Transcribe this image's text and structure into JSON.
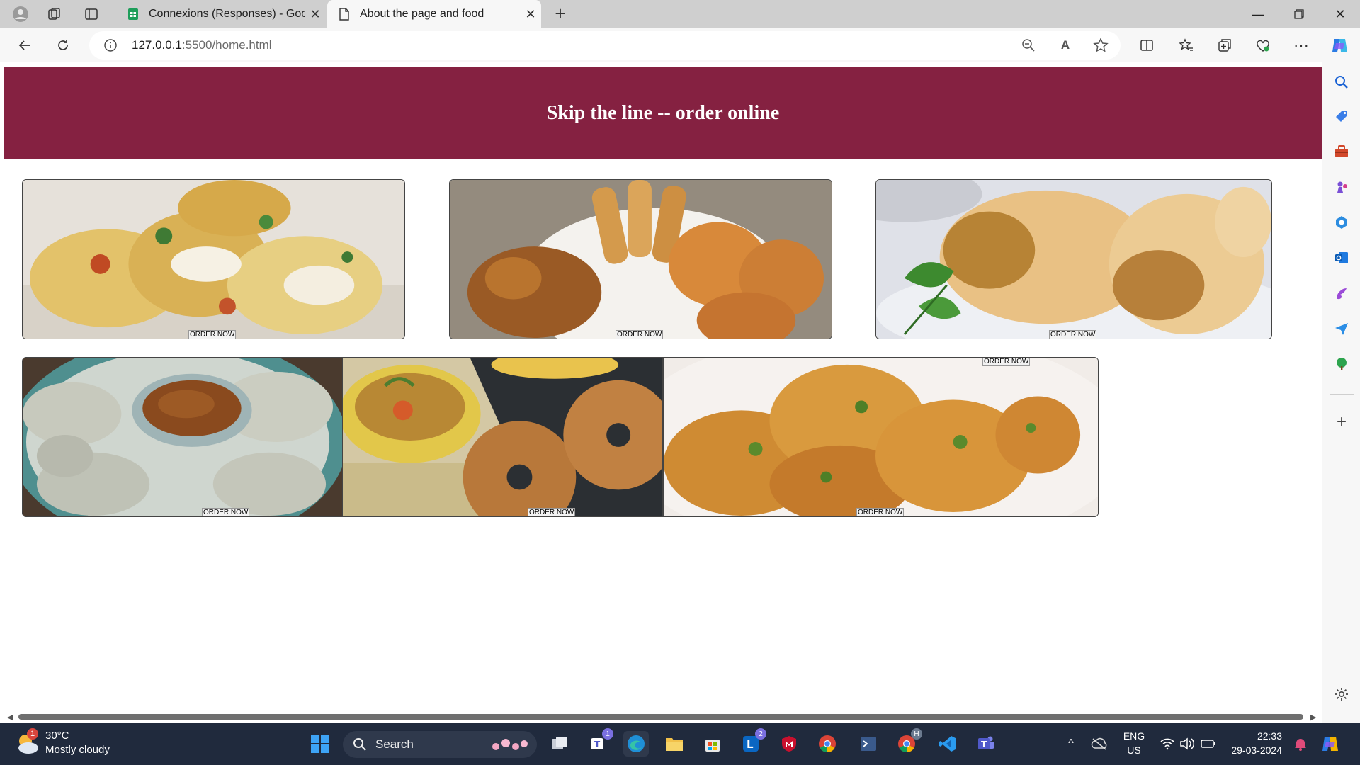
{
  "tabs": [
    {
      "title": "Connexions (Responses) - Google Sheets",
      "display": "Connexions (Responses) - Googl"
    },
    {
      "title": "About the page and food"
    }
  ],
  "address_bar": {
    "host": "127.0.0.1",
    "path": ":5500/home.html"
  },
  "page": {
    "banner_title": "Skip the line -- order online",
    "items": [
      {
        "food": "dahi puri",
        "button": "ORDER NOW"
      },
      {
        "food": "samosa and pakora platter",
        "button": "ORDER NOW"
      },
      {
        "food": "vada pav",
        "button": "ORDER NOW"
      },
      {
        "food": "momos",
        "button": "ORDER NOW"
      },
      {
        "food": "medu vada with sambar",
        "button": "ORDER NOW"
      },
      {
        "food": "pakora fritters",
        "button": "ORDER NOW",
        "button_top": "ORDER NOW"
      }
    ]
  },
  "taskbar": {
    "weather": {
      "temp": "30°C",
      "condition": "Mostly cloudy",
      "badge": "1"
    },
    "search_label": "Search",
    "teams_badge": "1",
    "linkedin_badge": "2",
    "chrome_badge": "H",
    "lang": {
      "line1": "ENG",
      "line2": "US"
    },
    "clock": {
      "time": "22:33",
      "date": "29-03-2024"
    }
  },
  "colors": {
    "banner": "#852141",
    "taskbar": "#202a3d"
  }
}
